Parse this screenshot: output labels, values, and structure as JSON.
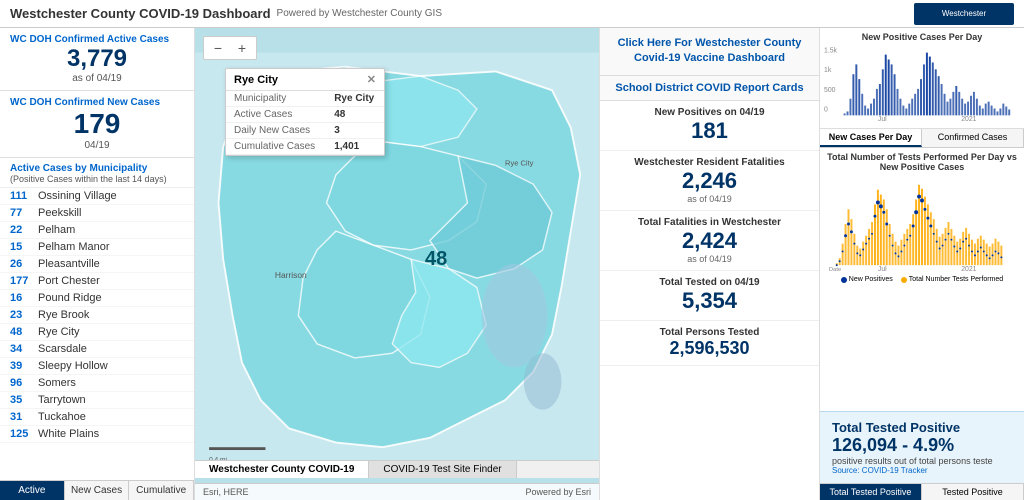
{
  "header": {
    "title": "Westchester County COVID-19 Dashboard",
    "subtitle": "Powered by Westchester County GIS",
    "logo_text": "Westchester"
  },
  "left_panel": {
    "active_cases_label": "WC DOH Confirmed Active Cases",
    "active_cases_value": "3,779",
    "active_cases_date": "as of 04/19",
    "new_cases_label": "WC DOH Confirmed New Cases",
    "new_cases_value": "179",
    "new_cases_date": "04/19",
    "municipality_header": "Active Cases by Municipality",
    "municipality_subheader": "(Positive Cases within the last 14 days)",
    "municipalities": [
      {
        "count": "111",
        "name": "Ossining Village"
      },
      {
        "count": "77",
        "name": "Peekskill"
      },
      {
        "count": "22",
        "name": "Pelham"
      },
      {
        "count": "15",
        "name": "Pelham Manor"
      },
      {
        "count": "26",
        "name": "Pleasantville"
      },
      {
        "count": "177",
        "name": "Port Chester"
      },
      {
        "count": "16",
        "name": "Pound Ridge"
      },
      {
        "count": "23",
        "name": "Rye Brook"
      },
      {
        "count": "48",
        "name": "Rye City"
      },
      {
        "count": "34",
        "name": "Scarsdale"
      },
      {
        "count": "39",
        "name": "Sleepy Hollow"
      },
      {
        "count": "96",
        "name": "Somers"
      },
      {
        "count": "35",
        "name": "Tarrytown"
      },
      {
        "count": "31",
        "name": "Tuckahoe"
      },
      {
        "count": "125",
        "name": "White Plains"
      }
    ],
    "tabs": [
      "Active",
      "New Cases",
      "Cumulative"
    ]
  },
  "map": {
    "popup": {
      "title": "Rye City",
      "rows": [
        {
          "label": "Municipality",
          "value": "Rye City"
        },
        {
          "label": "Active Cases",
          "value": "48"
        },
        {
          "label": "Daily New Cases",
          "value": "3"
        },
        {
          "label": "Cumulative Cases",
          "value": "1,401"
        }
      ]
    },
    "number_label": "48",
    "bottom_attribution": "Esri, HERE",
    "tabs": [
      "Westchester County COVID-19",
      "COVID-19 Test Site Finder"
    ],
    "powered": "Powered by Esri"
  },
  "right_stats": {
    "vaccine_btn": "Click Here For Westchester County\nCovid-19 Vaccine Dashboard",
    "school_btn": "School District COVID Report Cards",
    "new_positives_label": "New Positives on 04/19",
    "new_positives_value": "181",
    "fatalities_label": "Westchester Resident Fatalities",
    "fatalities_value": "2,246",
    "fatalities_date": "as of 04/19",
    "total_fatalities_label": "Total Fatalities in Westchester",
    "total_fatalities_value": "2,424",
    "total_fatalities_date": "as of 04/19",
    "total_tested_label": "Total Tested on 04/19",
    "total_tested_value": "5,354",
    "total_persons_label": "Total Persons Tested",
    "total_persons_value": "2,596,530"
  },
  "charts": {
    "new_cases_title": "New Positive Cases Per Day",
    "tabs": [
      "New Cases Per Day",
      "Confirmed Cases"
    ],
    "dual_chart_title": "Total Number of Tests Performed Per Day vs New Positive Cases",
    "legend": [
      {
        "label": "New Positives",
        "color": "#003399"
      },
      {
        "label": "Total Number Tests Performed",
        "color": "#ffaa00"
      }
    ],
    "x_labels": [
      "Jul",
      "2021"
    ],
    "x_labels2": [
      "Jul",
      "2021"
    ]
  },
  "total_tested_box": {
    "title": "Total Tested Positive",
    "value": "126,094 - 4.9%",
    "sub": "positive results out of total persons teste",
    "source": "Source: COVID-19 Tracker",
    "tabs": [
      "Total Tested Positive",
      "Tested Positive"
    ]
  }
}
